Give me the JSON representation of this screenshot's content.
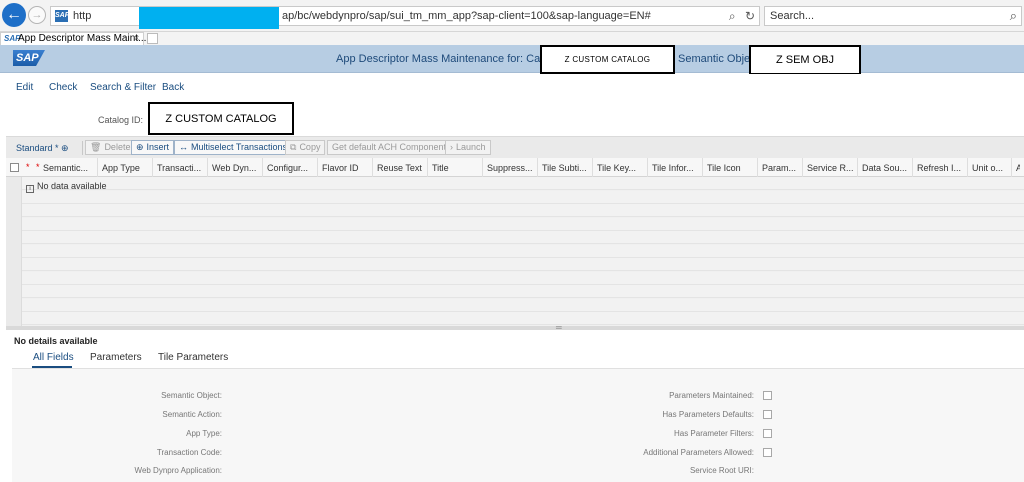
{
  "browser": {
    "url_prefix": "http",
    "url_path": "ap/bc/webdynpro/sap/sui_tm_mm_app?sap-client=100&sap-language=EN#",
    "search_placeholder": "Search...",
    "tab_label": "App Descriptor Mass Maint...",
    "tab_close": "×",
    "tab_favicon": "SAP",
    "tools": {
      "search": "⌕",
      "refresh": "↻"
    }
  },
  "shell": {
    "logo": "SAP",
    "title": "App Descriptor Mass Maintenance for: Catalog ID",
    "title_suffix": "Semantic Object"
  },
  "overlays": {
    "catalog_small": "Z  CUSTOM  CATALOG",
    "sem_obj": "Z  SEM   OBJ",
    "catalog_big": "Z  CUSTOM   CATALOG"
  },
  "menu": [
    "Edit",
    "Check",
    "Search & Filter",
    "Back"
  ],
  "catalog": {
    "label": "Catalog ID:"
  },
  "toolbar": {
    "variant": "Standard *",
    "buttons": [
      {
        "label": "Delete",
        "icon": "🗑",
        "enabled": false
      },
      {
        "label": "Insert",
        "icon": "⊕",
        "enabled": true
      },
      {
        "label": "Multiselect Transactions",
        "icon": "↔",
        "enabled": true
      },
      {
        "label": "Copy",
        "icon": "⧉",
        "enabled": false
      },
      {
        "label": "Get default ACH Components",
        "icon": "",
        "enabled": false
      },
      {
        "label": "Launch",
        "icon": "›",
        "enabled": false
      }
    ]
  },
  "table": {
    "columns": [
      "Semantic...",
      "App Type",
      "Transacti...",
      "Web Dyn...",
      "Configur...",
      "Flavor ID",
      "Reuse Text",
      "Title",
      "Suppress...",
      "Tile Subti...",
      "Tile Key...",
      "Tile Infor...",
      "Tile Icon",
      "Param...",
      "Service R...",
      "Data Sou...",
      "Refresh I...",
      "Unit o...",
      "A"
    ],
    "required_marker": "*",
    "empty_text": "No data available",
    "empty_icon": "i",
    "splitter_grip": "═"
  },
  "details": {
    "title": "No details available",
    "tabs": [
      "All Fields",
      "Parameters",
      "Tile Parameters"
    ],
    "left_fields": [
      "Semantic Object:",
      "Semantic Action:",
      "App Type:",
      "Transaction Code:",
      "Web Dynpro Application:"
    ],
    "right_fields": [
      "Parameters Maintained:",
      "Has Parameters Defaults:",
      "Has Parameter Filters:",
      "Additional Parameters Allowed:",
      "Service Root URI:"
    ]
  }
}
